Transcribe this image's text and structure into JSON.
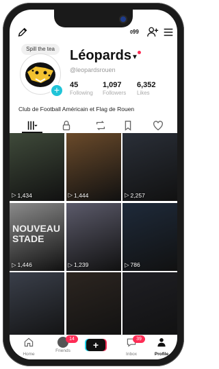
{
  "status": {
    "alerts": "99"
  },
  "profile": {
    "badge_text": "Spill the tea",
    "name": "Léopards",
    "handle": "@leopardsrouen",
    "bio": "Club de Football Américain et Flag de Rouen",
    "stats": [
      {
        "value": "45",
        "label": "Following"
      },
      {
        "value": "1,097",
        "label": "Followers"
      },
      {
        "value": "6,352",
        "label": "Likes"
      }
    ]
  },
  "tabs": [
    "videos-grid",
    "lock",
    "repost",
    "bookmark",
    "heart"
  ],
  "videos": [
    {
      "views": "1,434",
      "bg": "#3f4a3a"
    },
    {
      "views": "1,444",
      "bg": "#6a4a2a"
    },
    {
      "views": "2,257",
      "bg": "#2a2f38"
    },
    {
      "views": "1,446",
      "bg": "#8a8a8a",
      "overlay": "NOUVEAU\nSTADE"
    },
    {
      "views": "1,239",
      "bg": "#5b5a6a"
    },
    {
      "views": "786",
      "bg": "#1e2a3a"
    },
    {
      "views": "",
      "bg": "#3a3f4a"
    },
    {
      "views": "",
      "bg": "#2c2520"
    },
    {
      "views": "",
      "bg": "#1f1f24"
    }
  ],
  "nav": {
    "home": "Home",
    "friends": "Friends",
    "friends_badge": "14",
    "create": "+",
    "inbox": "Inbox",
    "inbox_badge": "39",
    "profile": "Profile"
  },
  "colors": {
    "accent": "#fe2c55",
    "cyan": "#20c4d8"
  }
}
